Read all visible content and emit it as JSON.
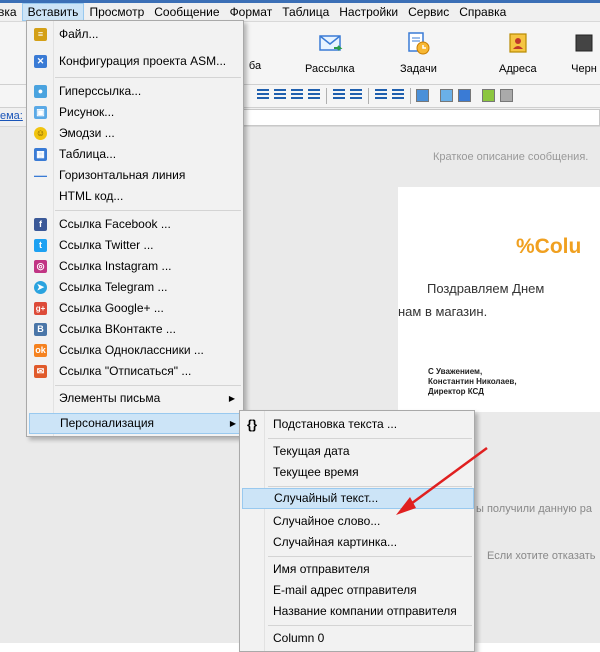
{
  "menubar": {
    "items": [
      "вка",
      "Вставить",
      "Просмотр",
      "Сообщение",
      "Формат",
      "Таблица",
      "Настройки",
      "Сервис",
      "Справка"
    ]
  },
  "ribbon": {
    "buttons": [
      {
        "label": "ба",
        "icon": "partial-icon"
      },
      {
        "label": "Рассылка",
        "icon": "mail-send-icon"
      },
      {
        "label": "Задачи",
        "icon": "tasks-clock-icon"
      },
      {
        "label": "Адреса",
        "icon": "address-book-icon"
      },
      {
        "label": "Черн",
        "icon": "blacklist-icon"
      }
    ]
  },
  "addressbar": {
    "label": "ема:"
  },
  "insert_menu": {
    "items": [
      {
        "label": "Файл...",
        "icon": "file-icon",
        "color": "#d4a017"
      },
      {
        "label": "Конфигурация проекта ASM...",
        "icon": "project-config-icon",
        "color": "#3a7bd5"
      },
      {
        "label": "Гиперссылка...",
        "icon": "hyperlink-icon",
        "color": "#4aa3df"
      },
      {
        "label": "Рисунок...",
        "icon": "picture-icon",
        "color": "#5aa9e6"
      },
      {
        "label": "Эмодзи ...",
        "icon": "emoji-icon",
        "color": "#f1c40f"
      },
      {
        "label": "Таблица...",
        "icon": "table-icon",
        "color": "#3a7bd5"
      },
      {
        "label": "Горизонтальная линия",
        "icon": "horizontal-line-icon",
        "color": "#3a7bd5"
      },
      {
        "label": "HTML код...",
        "icon": "",
        "color": ""
      },
      {
        "label": "Ссылка Facebook ...",
        "icon": "facebook-icon",
        "color": "#3b5998"
      },
      {
        "label": "Ссылка Twitter ...",
        "icon": "twitter-icon",
        "color": "#1da1f2"
      },
      {
        "label": "Ссылка Instagram ...",
        "icon": "instagram-icon",
        "color": "#c13584"
      },
      {
        "label": "Ссылка Telegram ...",
        "icon": "telegram-icon",
        "color": "#2aa3df"
      },
      {
        "label": "Ссылка Google+ ...",
        "icon": "google-plus-icon",
        "color": "#dd4b39"
      },
      {
        "label": "Ссылка ВКонтакте ...",
        "icon": "vk-icon",
        "color": "#4a76a8"
      },
      {
        "label": "Ссылка Одноклассники ...",
        "icon": "odnoklassniki-icon",
        "color": "#f58220"
      },
      {
        "label": "Ссылка \"Отписаться\" ...",
        "icon": "unsubscribe-icon",
        "color": "#e05a2b"
      },
      {
        "label": "Элементы письма",
        "icon": "",
        "color": ""
      },
      {
        "label": "Персонализация",
        "icon": "",
        "color": ""
      }
    ]
  },
  "personalization_menu": {
    "items": [
      {
        "label": "Подстановка текста ...",
        "icon": "braces-icon"
      },
      {
        "label": "Текущая дата"
      },
      {
        "label": "Текущее время"
      },
      {
        "label": "Случайный текст..."
      },
      {
        "label": "Случайное слово..."
      },
      {
        "label": "Случайная картинка..."
      },
      {
        "label": "Имя отправителя"
      },
      {
        "label": "E-mail адрес отправителя"
      },
      {
        "label": "Название компании отправителя"
      },
      {
        "label": "Column 0"
      }
    ],
    "highlighted": "Случайный текст..."
  },
  "editor": {
    "preheader": "Краткое описание сообщения.",
    "title": "%Colu",
    "body_line1": "Поздравляем  Днем",
    "body_line2": "нам в магазин.",
    "signature": [
      "С Уважением,",
      "Константин Николаев,",
      "Директор КСД"
    ],
    "footer1": "ы получили данную ра",
    "footer2": "Если хотите отказать"
  },
  "colors": {
    "accent": "#cce4f7",
    "title_orange": "#f0a020",
    "arrow_red": "#e02020"
  }
}
